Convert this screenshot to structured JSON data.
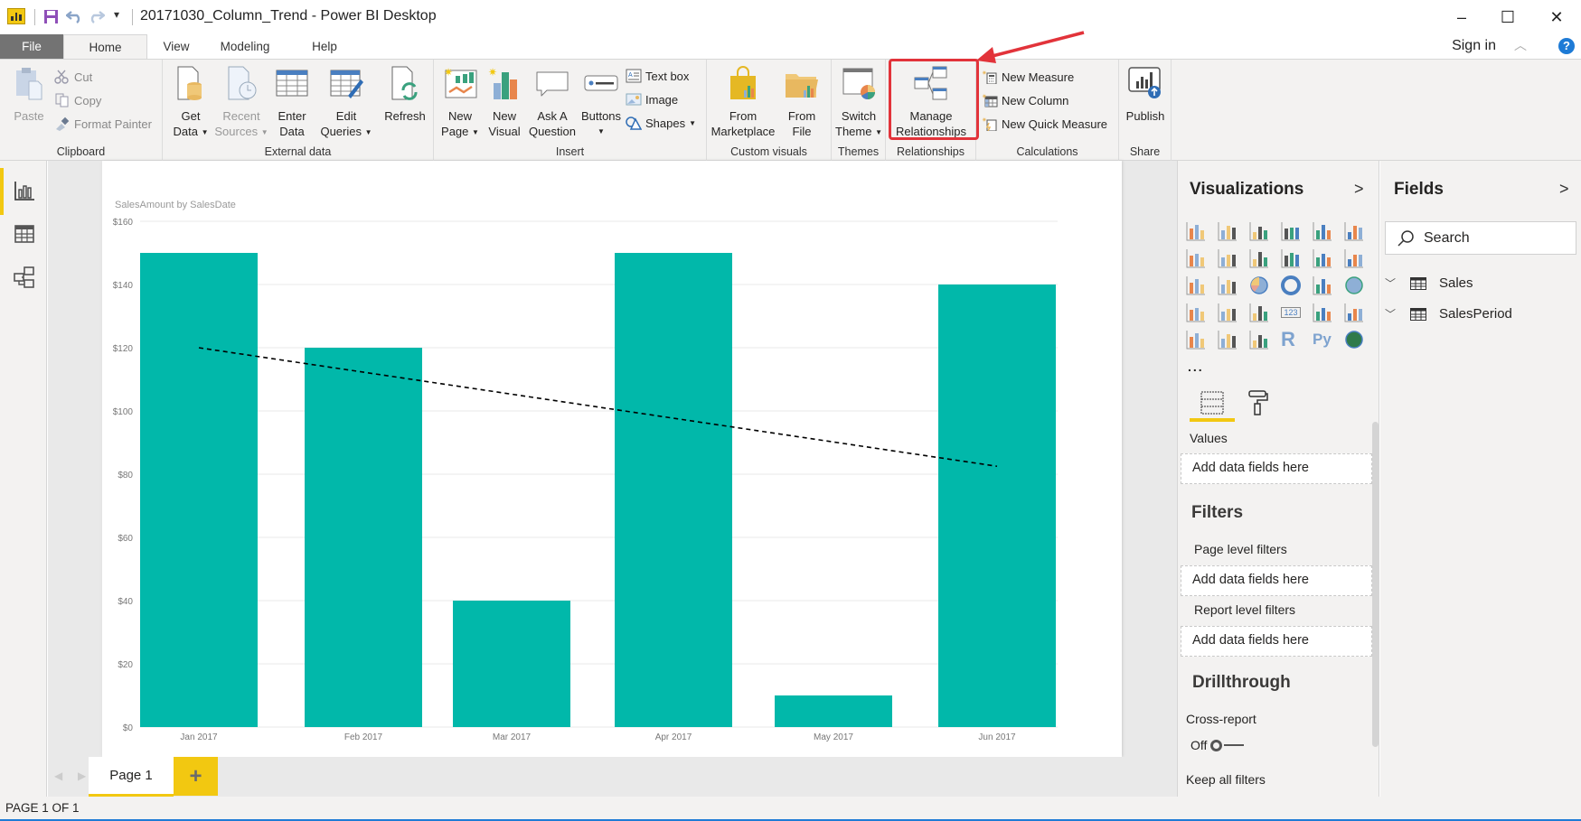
{
  "window": {
    "title": "20171030_Column_Trend - Power BI Desktop",
    "controls": {
      "minimize": "–",
      "maximize": "☐",
      "close": "✕"
    }
  },
  "quick_access": {
    "save_icon": "save-icon",
    "undo_icon": "undo-icon",
    "redo_icon": "redo-icon",
    "customize": "▾"
  },
  "menu_tabs": [
    {
      "label": "File"
    },
    {
      "label": "Home",
      "active": true
    },
    {
      "label": "View"
    },
    {
      "label": "Modeling"
    },
    {
      "label": "Help"
    }
  ],
  "account": {
    "sign_in": "Sign in",
    "help": "?"
  },
  "ribbon": {
    "groups": {
      "clipboard": "Clipboard",
      "external_data": "External data",
      "insert": "Insert",
      "custom_visuals": "Custom visuals",
      "themes": "Themes",
      "relationships": "Relationships",
      "calculations": "Calculations",
      "share": "Share"
    },
    "paste": "Paste",
    "cut": "Cut",
    "copy": "Copy",
    "format_painter": "Format Painter",
    "get_data": [
      "Get",
      "Data"
    ],
    "recent_sources": [
      "Recent",
      "Sources"
    ],
    "enter_data": [
      "Enter",
      "Data"
    ],
    "edit_queries": [
      "Edit",
      "Queries"
    ],
    "refresh": "Refresh",
    "new_page": [
      "New",
      "Page"
    ],
    "new_visual": [
      "New",
      "Visual"
    ],
    "ask_question": [
      "Ask A",
      "Question"
    ],
    "buttons": "Buttons",
    "text_box": "Text box",
    "image": "Image",
    "shapes": "Shapes",
    "from_marketplace": [
      "From",
      "Marketplace"
    ],
    "from_file": [
      "From",
      "File"
    ],
    "switch_theme": [
      "Switch",
      "Theme"
    ],
    "manage_relationships": [
      "Manage",
      "Relationships"
    ],
    "new_measure": "New Measure",
    "new_column": "New Column",
    "new_quick_measure": "New Quick Measure",
    "publish": "Publish"
  },
  "annotation": {
    "highlight_color": "#e2333a",
    "target": "Manage Relationships"
  },
  "left_nav": [
    {
      "name": "report-view",
      "active": true
    },
    {
      "name": "data-view"
    },
    {
      "name": "relationships-view"
    }
  ],
  "chart_data": {
    "type": "bar",
    "title": "SalesAmount by SalesDate",
    "xlabel": "",
    "ylabel": "",
    "categories": [
      "Jan 2017",
      "Feb 2017",
      "Mar 2017",
      "Apr 2017",
      "May 2017",
      "Jun 2017"
    ],
    "values": [
      150,
      120,
      40,
      150,
      10,
      140
    ],
    "ylim": [
      0,
      160
    ],
    "yticks": [
      0,
      20,
      40,
      60,
      80,
      100,
      120,
      140,
      160
    ],
    "ytick_labels": [
      "$0",
      "$20",
      "$40",
      "$60",
      "$80",
      "$100",
      "$120",
      "$140",
      "$160"
    ],
    "grid": true,
    "bar_color": "#01b8aa",
    "trend_line": {
      "style": "dashed",
      "color": "#000000",
      "start": 120,
      "end": 82.5
    }
  },
  "pages": {
    "tabs": [
      {
        "label": "Page 1",
        "active": true
      }
    ],
    "add_label": "+"
  },
  "status": {
    "page_indicator": "PAGE 1 OF 1"
  },
  "visualizations": {
    "title": "Visualizations",
    "icons": [
      "stacked-bar-chart-icon",
      "stacked-column-chart-icon",
      "clustered-bar-chart-icon",
      "clustered-column-chart-icon",
      "100-stacked-bar-chart-icon",
      "100-stacked-column-chart-icon",
      "line-chart-icon",
      "area-chart-icon",
      "stacked-area-chart-icon",
      "line-and-stacked-column-icon",
      "line-and-clustered-column-icon",
      "ribbon-chart-icon",
      "waterfall-chart-icon",
      "scatter-chart-icon",
      "pie-chart-icon",
      "donut-chart-icon",
      "treemap-icon",
      "map-icon",
      "filled-map-icon",
      "funnel-icon",
      "gauge-icon",
      "card-icon",
      "multi-row-card-icon",
      "kpi-icon",
      "slicer-icon",
      "table-icon",
      "matrix-icon",
      "r-script-visual-icon",
      "python-visual-icon",
      "arcgis-map-icon"
    ],
    "more": "...",
    "values_label": "Values",
    "values_placeholder": "Add data fields here",
    "filters_title": "Filters",
    "page_filters_label": "Page level filters",
    "page_filters_placeholder": "Add data fields here",
    "report_filters_label": "Report level filters",
    "report_filters_placeholder": "Add data fields here",
    "drillthrough_title": "Drillthrough",
    "cross_report_label": "Cross-report",
    "cross_report_state": "Off",
    "keep_filters_label": "Keep all filters"
  },
  "fields": {
    "title": "Fields",
    "search_placeholder": "Search",
    "tables": [
      {
        "name": "Sales"
      },
      {
        "name": "SalesPeriod"
      }
    ]
  }
}
